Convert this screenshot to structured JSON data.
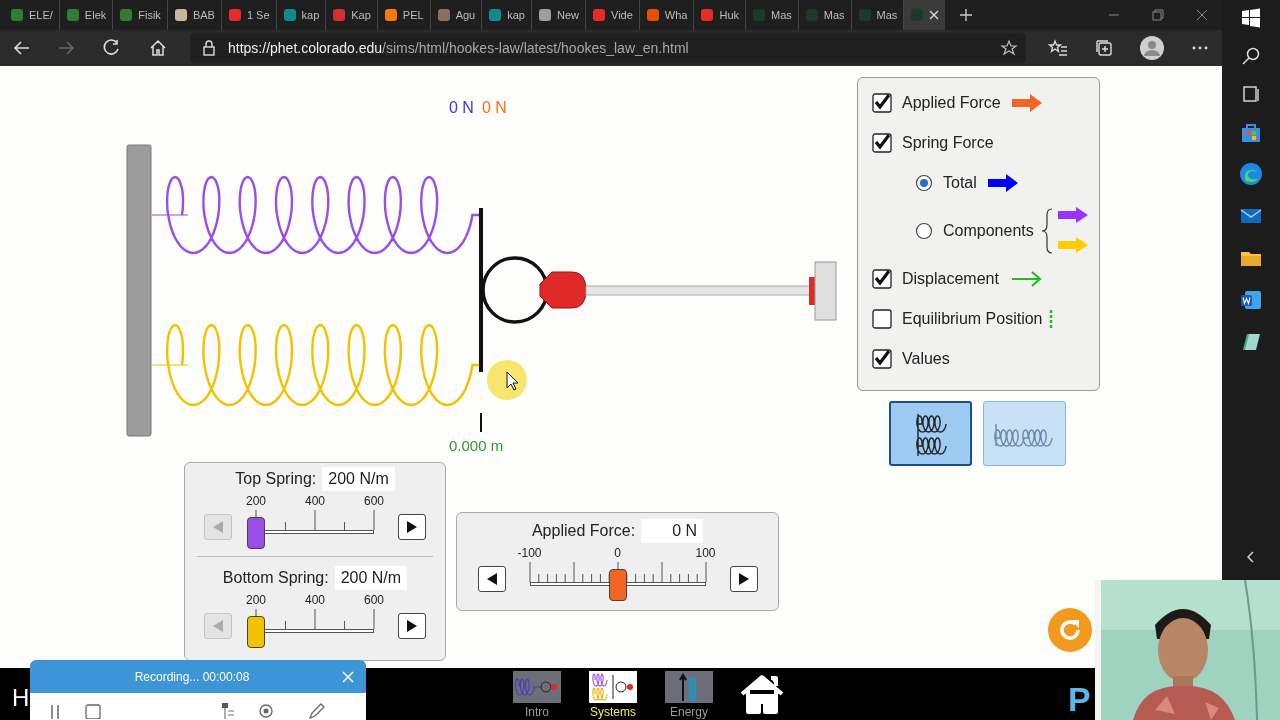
{
  "browser": {
    "tabs": [
      {
        "title": "ELE/",
        "color": "#2e7d32",
        "selected": false
      },
      {
        "title": "Elek",
        "color": "#2e7d32",
        "selected": false
      },
      {
        "title": "Fisik",
        "color": "#2e7d32",
        "selected": false
      },
      {
        "title": "BAB",
        "color": "#c8b89a",
        "selected": false
      },
      {
        "title": "1 Se",
        "color": "#e52d27",
        "selected": false
      },
      {
        "title": "kap",
        "color": "#138a8a",
        "selected": false
      },
      {
        "title": "Kap",
        "color": "#d32f2f",
        "selected": false
      },
      {
        "title": "PEL",
        "color": "#f57c00",
        "selected": false
      },
      {
        "title": "Agu",
        "color": "#8d6e63",
        "selected": false
      },
      {
        "title": "kap",
        "color": "#138a8a",
        "selected": false
      },
      {
        "title": "New",
        "color": "#9e9e9e",
        "selected": false
      },
      {
        "title": "Vide",
        "color": "#e52d27",
        "selected": false
      },
      {
        "title": "Wha",
        "color": "#e65100",
        "selected": false
      },
      {
        "title": "Huk",
        "color": "#e52d27",
        "selected": false
      },
      {
        "title": "Mas",
        "color": "#1b3a2a",
        "selected": false
      },
      {
        "title": "Mas",
        "color": "#1b3a2a",
        "selected": false
      },
      {
        "title": "Mas",
        "color": "#1b3a2a",
        "selected": false
      },
      {
        "color": "#1b3a2a",
        "selected": true
      }
    ],
    "url_host": "https://phet.colorado.edu",
    "url_path": "/sims/html/hookes-law/latest/hookes_law_en.html"
  },
  "sim": {
    "force_readouts": [
      {
        "text": "0 N",
        "color": "#3b3bd6"
      },
      {
        "text": "0 N",
        "color": "#f0701e"
      }
    ],
    "displacement_value": "0.000 m",
    "options": [
      {
        "kind": "checkbox",
        "label": "Applied Force",
        "checked": true,
        "symbol": {
          "kind": "arrow",
          "color": "#f26522"
        }
      },
      {
        "kind": "checkbox",
        "label": "Spring Force",
        "checked": true,
        "children": [
          {
            "kind": "radio",
            "label": "Total",
            "selected": true,
            "symbol": {
              "kind": "arrow",
              "color": "#0000ff"
            }
          },
          {
            "kind": "radio",
            "label": "Components",
            "selected": false,
            "symbol": {
              "kind": "brace-arrows",
              "arrows": [
                {
                  "color": "#9933ff"
                },
                {
                  "color": "#ffcc00"
                }
              ]
            }
          }
        ]
      },
      {
        "kind": "checkbox",
        "label": "Displacement",
        "checked": true,
        "symbol": {
          "kind": "line-arrow",
          "color": "#22bb22"
        }
      },
      {
        "kind": "checkbox",
        "label": "Equilibrium Position",
        "checked": false,
        "symbol": {
          "kind": "dotted-line",
          "color": "#22bb22"
        }
      },
      {
        "kind": "checkbox",
        "label": "Values",
        "checked": true
      }
    ],
    "configurations": [
      {
        "kind": "parallel",
        "selected": true
      },
      {
        "kind": "series",
        "selected": false
      }
    ],
    "spring_sliders": [
      {
        "label": "Top Spring:",
        "value": "200 N/m",
        "ticks": [
          "200",
          "400",
          "600"
        ],
        "level": 0,
        "color": "#9b4de8",
        "kind": "spring"
      },
      {
        "label": "Bottom Spring:",
        "value": "200 N/m",
        "ticks": [
          "200",
          "400",
          "600"
        ],
        "level": 0,
        "color": "#f2c200",
        "kind": "spring"
      }
    ],
    "force_slider": {
      "label": "Applied Force:",
      "value": "0 N",
      "ticks": [
        "-100",
        "0",
        "100"
      ],
      "level": 0.5,
      "color": "#f26522",
      "kind": "force"
    }
  },
  "navbar": {
    "left_text": "H",
    "screens": [
      {
        "label": "Intro",
        "kind": "intro",
        "selected": false
      },
      {
        "label": "Systems",
        "kind": "systems",
        "selected": true
      },
      {
        "label": "Energy",
        "kind": "energy",
        "selected": false
      }
    ],
    "logo_text": "P"
  },
  "recorder": {
    "status": "Recording... 00:00:08"
  }
}
